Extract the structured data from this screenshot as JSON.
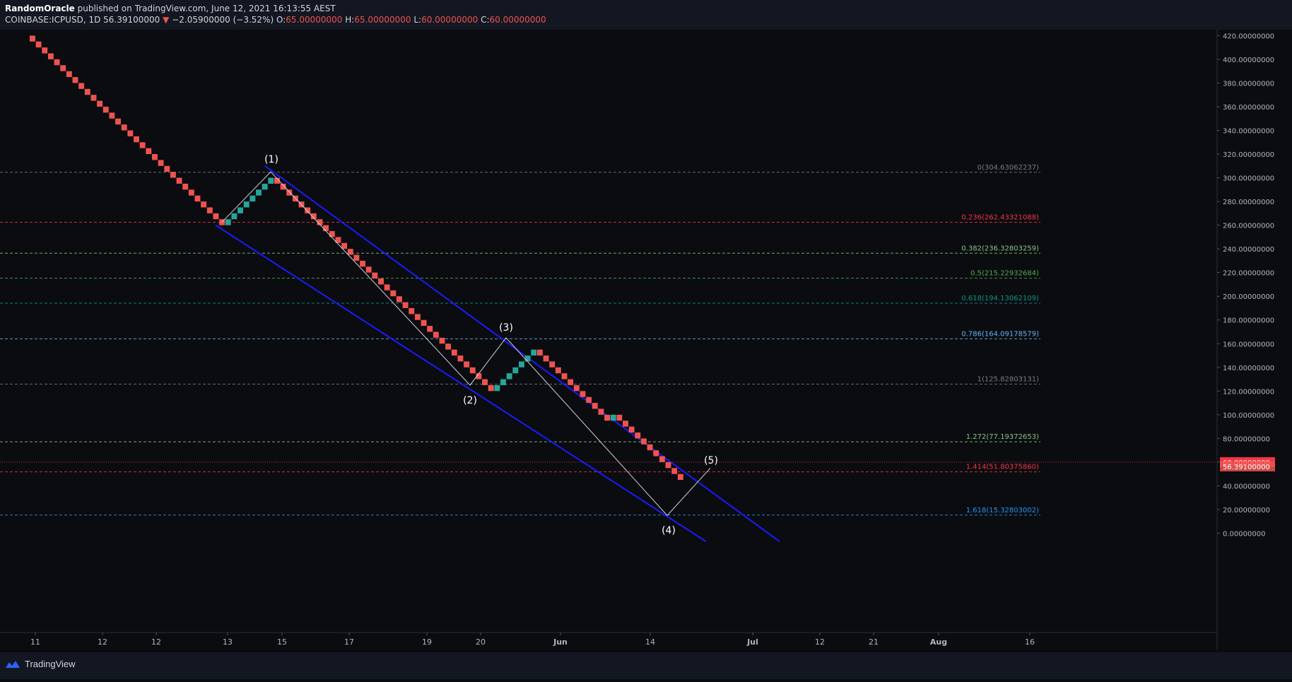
{
  "header": {
    "author": "RandomOracle",
    "published": " published on TradingView.com, June 12, 2021 16:13:55 AEST",
    "symbol": "COINBASE:ICPUSD, 1D",
    "last": "56.39100000",
    "change_arrow": "▼",
    "change": "−2.05900000 (−3.52%)",
    "o_label": "O:",
    "o_value": "65.00000000",
    "h_label": "H:",
    "h_value": "65.00000000",
    "l_label": "L:",
    "l_value": "60.00000000",
    "c_label": "C:",
    "c_value": "60.00000000"
  },
  "footer": {
    "brand": "TradingView",
    "logo_icon": "tradingview-logo-icon"
  },
  "colors": {
    "bg": "#0b0c10",
    "panel": "#131722",
    "up": "#26a69a",
    "down": "#ef5350",
    "channel": "#1a1aff",
    "wave": "#d1d4dc",
    "axis_text": "#b2b5be"
  },
  "chart_data": {
    "type": "renko",
    "symbol": "COINBASE:ICPUSD",
    "interval": "1D",
    "ylim": [
      -6,
      428
    ],
    "y_ticks": [
      "420.00000000",
      "400.00000000",
      "380.00000000",
      "360.00000000",
      "340.00000000",
      "320.00000000",
      "300.00000000",
      "280.00000000",
      "260.00000000",
      "240.00000000",
      "220.00000000",
      "200.00000000",
      "180.00000000",
      "160.00000000",
      "140.00000000",
      "120.00000000",
      "100.00000000",
      "80.00000000",
      "60.00000000",
      "40.00000000",
      "20.00000000",
      "0.00000000"
    ],
    "y_tick_values": [
      420,
      400,
      380,
      360,
      340,
      320,
      300,
      280,
      260,
      240,
      220,
      200,
      180,
      160,
      140,
      120,
      100,
      80,
      60,
      40,
      20,
      0
    ],
    "x_ticks": [
      {
        "label": "11",
        "bold": false
      },
      {
        "label": "12",
        "bold": false
      },
      {
        "label": "12",
        "bold": false
      },
      {
        "label": "13",
        "bold": false
      },
      {
        "label": "15",
        "bold": false
      },
      {
        "label": "17",
        "bold": false
      },
      {
        "label": "19",
        "bold": false
      },
      {
        "label": "20",
        "bold": false
      },
      {
        "label": "Jun",
        "bold": true
      },
      {
        "label": "14",
        "bold": false
      },
      {
        "label": "Jul",
        "bold": true
      },
      {
        "label": "12",
        "bold": false
      },
      {
        "label": "21",
        "bold": false
      },
      {
        "label": "Aug",
        "bold": true
      },
      {
        "label": "16",
        "bold": false
      }
    ],
    "brick_size": 5,
    "bricks": {
      "start": 420,
      "runs": [
        {
          "dir": -1,
          "count": 32
        },
        {
          "dir": 1,
          "count": 8
        },
        {
          "dir": -1,
          "count": 36
        },
        {
          "dir": 1,
          "count": 7
        },
        {
          "dir": -1,
          "count": 12
        },
        {
          "dir": 1,
          "count": 1
        },
        {
          "dir": -1,
          "count": 11
        }
      ]
    },
    "fib_levels": [
      {
        "label": "0(304.63062237)",
        "value": 304.63062237,
        "color": "#787b86"
      },
      {
        "label": "0.236(262.43321088)",
        "value": 262.43321088,
        "color": "#f23645"
      },
      {
        "label": "0.382(236.32803259)",
        "value": 236.32803259,
        "color": "#81c784"
      },
      {
        "label": "0.5(215.22932684)",
        "value": 215.22932684,
        "color": "#4caf50"
      },
      {
        "label": "0.618(194.13062109)",
        "value": 194.13062109,
        "color": "#089981"
      },
      {
        "label": "0.786(164.09178579)",
        "value": 164.09178579,
        "color": "#64b5f6"
      },
      {
        "label": "1(125.82803131)",
        "value": 125.82803131,
        "color": "#787b86"
      },
      {
        "label": "1.272(77.19372653)",
        "value": 77.19372653,
        "color": "#81c784"
      },
      {
        "label": "1.414(51.80375860)",
        "value": 51.8037586,
        "color": "#f23645"
      },
      {
        "label": "1.618(15.32803002)",
        "value": 15.32803002,
        "color": "#2196f3"
      }
    ],
    "wave_labels": [
      {
        "label": "(1)",
        "value": 305
      },
      {
        "label": "(2)",
        "value": 125
      },
      {
        "label": "(3)",
        "value": 165
      },
      {
        "label": "(4)",
        "value": 15
      },
      {
        "label": "(5)",
        "value": 55
      }
    ],
    "price_tags": [
      {
        "label": "60.00000000",
        "value": 60,
        "color": "#f23645"
      },
      {
        "label": "56.39100000",
        "value": 56.391,
        "color": "#ef5350"
      }
    ]
  }
}
